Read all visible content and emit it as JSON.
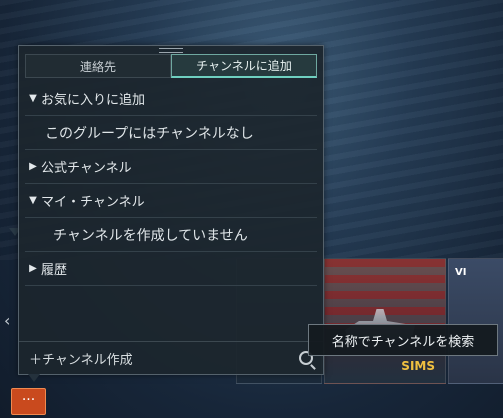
{
  "tabs": [
    {
      "label": "連絡先"
    },
    {
      "label": "チャンネルに追加"
    }
  ],
  "groups": {
    "favorites": {
      "label": "お気に入りに追加",
      "arrow": "▼"
    },
    "favorites_empty": {
      "text": "このグループにはチャンネルなし"
    },
    "official": {
      "label": "公式チャンネル",
      "arrow": "▶"
    },
    "my_channels": {
      "label": "マイ・チャンネル",
      "arrow": "▼"
    },
    "my_channels_empty": {
      "text": "チャンネルを作成していません"
    },
    "history": {
      "label": "履歴",
      "arrow": "▶"
    }
  },
  "footer": {
    "create_label": "＋チャンネル作成"
  },
  "tooltip": {
    "text": "名称でチャンネルを検索"
  },
  "background": {
    "ship_name": "SIMS",
    "tier_label": "VI",
    "chat_button": "···",
    "left_arrow": "‹"
  },
  "colors": {
    "accent": "#6fd0c0",
    "chat_button": "#c94a1e"
  }
}
